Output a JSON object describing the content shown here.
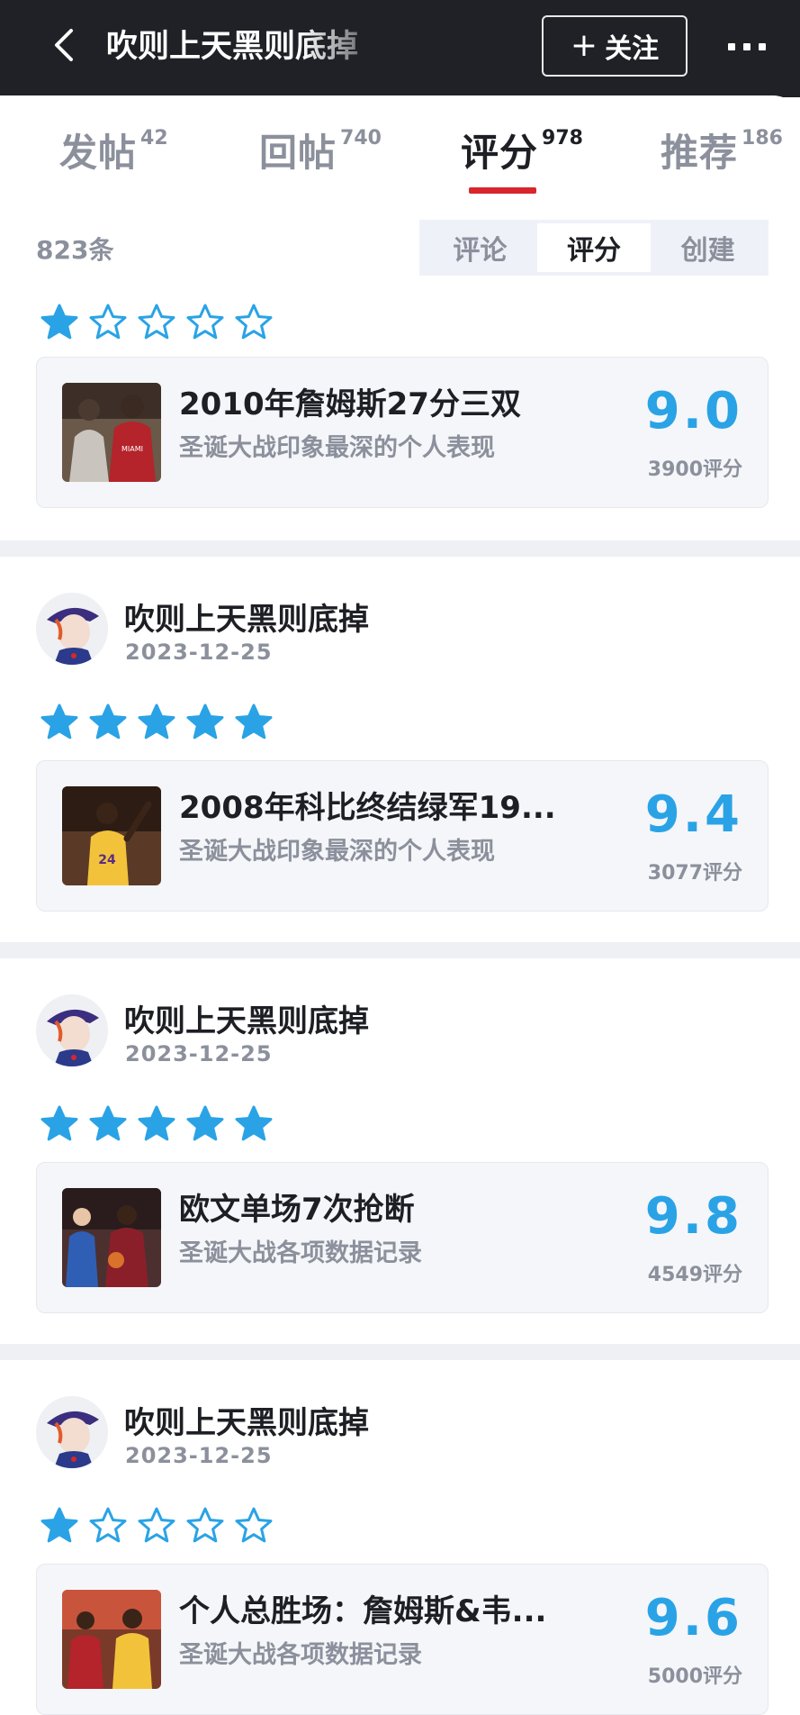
{
  "header": {
    "title": "吹则上天黑则底掉",
    "follow_label": "关注",
    "icons": {
      "back": "back-chevron-icon",
      "plus": "plus-icon",
      "more": "more-dots-icon"
    }
  },
  "tabs": [
    {
      "label": "发帖",
      "count": "42"
    },
    {
      "label": "回帖",
      "count": "740"
    },
    {
      "label": "评分",
      "count": "978"
    },
    {
      "label": "推荐",
      "count": "186"
    }
  ],
  "active_tab": "评分",
  "filter": {
    "total": "823条",
    "segments": [
      "评论",
      "评分",
      "创建"
    ],
    "active_segment": "评分"
  },
  "colors": {
    "header_bg": "#1f2126",
    "accent_red": "#d8262c",
    "star_blue": "#2aa3e6",
    "score_blue": "#2aa3e6",
    "muted_text": "#8b909c"
  },
  "posts": [
    {
      "user": null,
      "rating_stars": 1,
      "card": {
        "title": "2010年詹姆斯27分三双",
        "subtitle": "圣诞大战印象最深的个人表现",
        "score": "9.0",
        "ratings": "3900评分"
      }
    },
    {
      "user": {
        "name": "吹则上天黑则底掉",
        "date": "2023-12-25"
      },
      "rating_stars": 5,
      "card": {
        "title": "2008年科比终结绿军19...",
        "subtitle": "圣诞大战印象最深的个人表现",
        "score": "9.4",
        "ratings": "3077评分"
      }
    },
    {
      "user": {
        "name": "吹则上天黑则底掉",
        "date": "2023-12-25"
      },
      "rating_stars": 5,
      "card": {
        "title": "欧文单场7次抢断",
        "subtitle": "圣诞大战各项数据记录",
        "score": "9.8",
        "ratings": "4549评分"
      }
    },
    {
      "user": {
        "name": "吹则上天黑则底掉",
        "date": "2023-12-25"
      },
      "rating_stars": 1,
      "card": {
        "title": "个人总胜场：詹姆斯&韦...",
        "subtitle": "圣诞大战各项数据记录",
        "score": "9.6",
        "ratings": "5000评分"
      }
    }
  ]
}
